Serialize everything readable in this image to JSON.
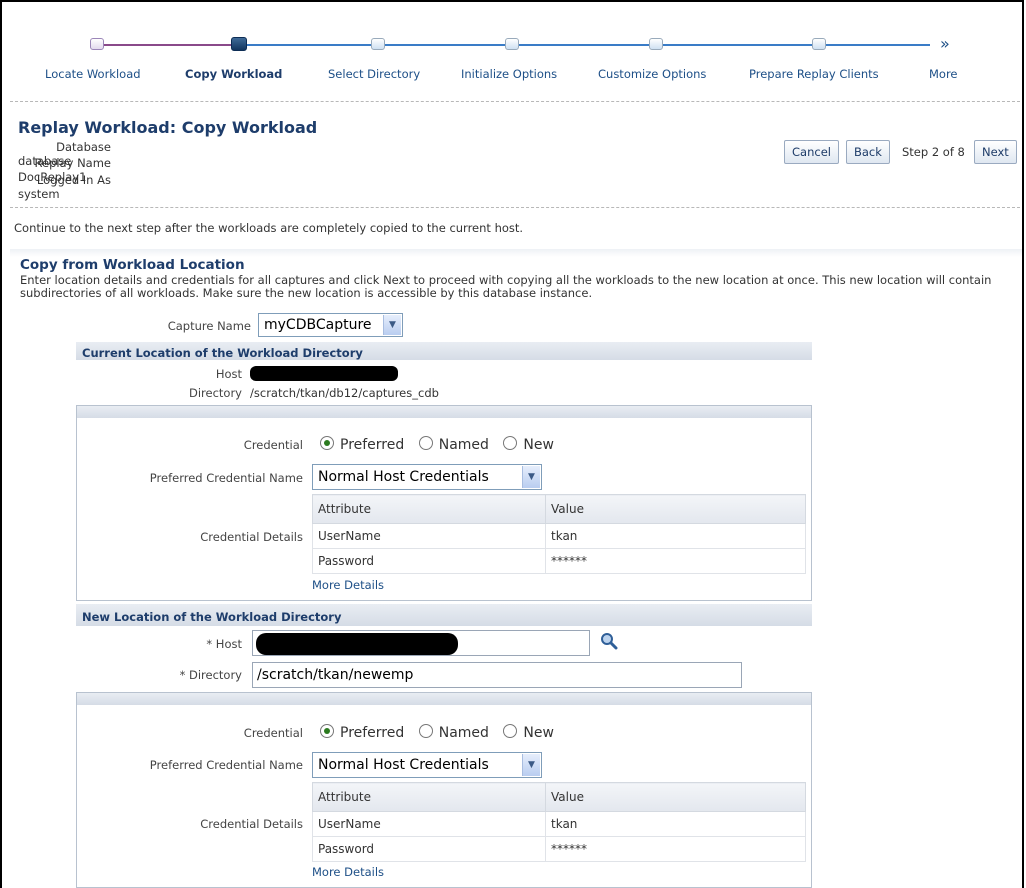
{
  "train": {
    "steps": [
      {
        "label": "Locate Workload",
        "state": "visited"
      },
      {
        "label": "Copy Workload",
        "state": "current"
      },
      {
        "label": "Select Directory",
        "state": "upcoming"
      },
      {
        "label": "Initialize Options",
        "state": "upcoming"
      },
      {
        "label": "Customize Options",
        "state": "upcoming"
      },
      {
        "label": "Prepare Replay Clients",
        "state": "upcoming"
      },
      {
        "label": "More",
        "state": "more"
      }
    ]
  },
  "header": {
    "title": "Replay Workload: Copy Workload",
    "info": [
      {
        "label": "Database",
        "value": "database"
      },
      {
        "label": "Replay Name",
        "value": "DocReplay1"
      },
      {
        "label": "Logged In As",
        "value": "system"
      }
    ],
    "buttons": {
      "cancel": "Cancel",
      "back": "Back",
      "step": "Step 2 of 8",
      "next": "Next"
    }
  },
  "instruction": "Continue to the next step after the workloads are completely copied to the current host.",
  "copy_section": {
    "title": "Copy from Workload Location",
    "description": "Enter location details and credentials for all captures and click Next to proceed with copying all the workloads to the new location at once. This new location will contain subdirectories of all workloads. Make sure the new location is accessible by this database instance.",
    "capture_label": "Capture Name",
    "capture_value": "myCDBCapture"
  },
  "current_location": {
    "title": "Current Location of the Workload Directory",
    "host_label": "Host",
    "directory_label": "Directory",
    "directory_value": "/scratch/tkan/db12/captures_cdb"
  },
  "credentials1": {
    "credential_label": "Credential",
    "options": [
      "Preferred",
      "Named",
      "New"
    ],
    "selected": "Preferred",
    "pref_name_label": "Preferred Credential Name",
    "pref_name_value": "Normal Host Credentials",
    "details_label": "Credential Details",
    "table_headers": [
      "Attribute",
      "Value"
    ],
    "rows": [
      [
        "UserName",
        "tkan"
      ],
      [
        "Password",
        "******"
      ]
    ],
    "more": "More Details"
  },
  "new_location": {
    "title": "New Location of the Workload Directory",
    "host_label": "* Host",
    "directory_label": "* Directory",
    "directory_value": "/scratch/tkan/newemp"
  },
  "credentials2": {
    "credential_label": "Credential",
    "options": [
      "Preferred",
      "Named",
      "New"
    ],
    "selected": "Preferred",
    "pref_name_label": "Preferred Credential Name",
    "pref_name_value": "Normal Host Credentials",
    "details_label": "Credential Details",
    "table_headers": [
      "Attribute",
      "Value"
    ],
    "rows": [
      [
        "UserName",
        "tkan"
      ],
      [
        "Password",
        "******"
      ]
    ],
    "more": "More Details"
  }
}
